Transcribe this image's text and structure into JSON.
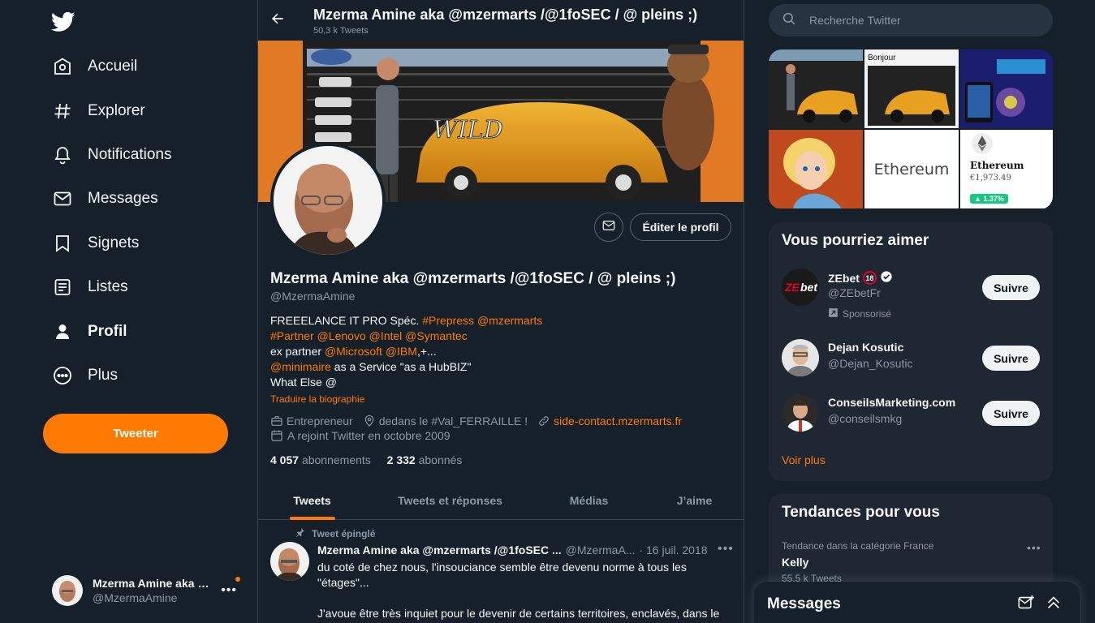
{
  "nav": {
    "items": [
      {
        "label": "Accueil",
        "icon": "home-icon"
      },
      {
        "label": "Explorer",
        "icon": "hashtag-icon"
      },
      {
        "label": "Notifications",
        "icon": "bell-icon"
      },
      {
        "label": "Messages",
        "icon": "envelope-icon"
      },
      {
        "label": "Signets",
        "icon": "bookmark-icon"
      },
      {
        "label": "Listes",
        "icon": "list-icon"
      },
      {
        "label": "Profil",
        "icon": "person-icon"
      },
      {
        "label": "Plus",
        "icon": "more-circle-icon"
      }
    ],
    "tweet_button": "Tweeter",
    "account_name": "Mzerma Amine aka @...",
    "account_handle": "@MzermaAmine"
  },
  "header": {
    "title": "Mzerma Amine aka @mzermarts /@1foSEC / @ pleins ;)",
    "tweet_count": "50,3 k Tweets"
  },
  "profile": {
    "edit_button": "Éditer le profil",
    "name": "Mzerma Amine aka @mzermarts /@1foSEC / @ pleins ;)",
    "handle": "@MzermaAmine",
    "bio": {
      "l1a": "FREEELANCE IT PRO Spéc. ",
      "l1b": "#Prepress @mzermarts",
      "l2": "#Partner @Lenovo @Intel @Symantec",
      "l3a": "ex partner ",
      "l3b": "@Microsoft @IBM",
      "l3c": ",+...",
      "l4a": "@minimaire",
      "l4b": " as a Service \"as a HubBIZ\"",
      "l5": "What Else @"
    },
    "translate": "Traduire la biographie",
    "job": "Entrepreneur",
    "location": "dedans le #Val_FERRAILLE !",
    "website": "side-contact.mzermarts.fr",
    "joined": "A rejoint Twitter en octobre 2009",
    "following_count": "4 057",
    "following_label": "abonnements",
    "followers_count": "2 332",
    "followers_label": "abonnés"
  },
  "tabs": [
    "Tweets",
    "Tweets et réponses",
    "Médias",
    "J’aime"
  ],
  "tweet": {
    "pinned_label": "Tweet épinglé",
    "author": "Mzerma Amine aka @mzermarts /@1foSEC ...",
    "handle": "@MzermaA...",
    "date": "· 16 juil. 2018",
    "text_1": "du coté de chez nous, l'insouciance semble être devenu norme à tous les \"étages\"...",
    "text_2": "J'avoue être très inquiet pour le devenir de certains territoires, enclavés, dans le"
  },
  "search": {
    "placeholder": "Recherche Twitter"
  },
  "media": {
    "tile_bonjour": "Bonjour",
    "tile_ethereum_big": "Ethereum",
    "tile_ethereum_name": "Ethereum",
    "tile_ethereum_price": "€1,973.49",
    "tile_ethereum_change": "▲ 1.37%"
  },
  "who_to_follow": {
    "title": "Vous pourriez aimer",
    "accounts": [
      {
        "name": "ZEbet",
        "badge": "18",
        "handle": "@ZEbetFr",
        "sponsored": "Sponsorisé",
        "button": "Suivre"
      },
      {
        "name": "Dejan Kosutic",
        "handle": "@Dejan_Kosutic",
        "button": "Suivre"
      },
      {
        "name": "ConseilsMarketing.com",
        "handle": "@conseilsmkg",
        "button": "Suivre"
      }
    ],
    "more": "Voir plus"
  },
  "trends": {
    "title": "Tendances pour vous",
    "category": "Tendance dans la catégorie France",
    "name": "Kelly",
    "count": "55,5 k Tweets"
  },
  "messages_drawer": {
    "title": "Messages"
  },
  "colors": {
    "accent": "#ff7a00",
    "background": "#15202b",
    "card": "#1e2732"
  }
}
